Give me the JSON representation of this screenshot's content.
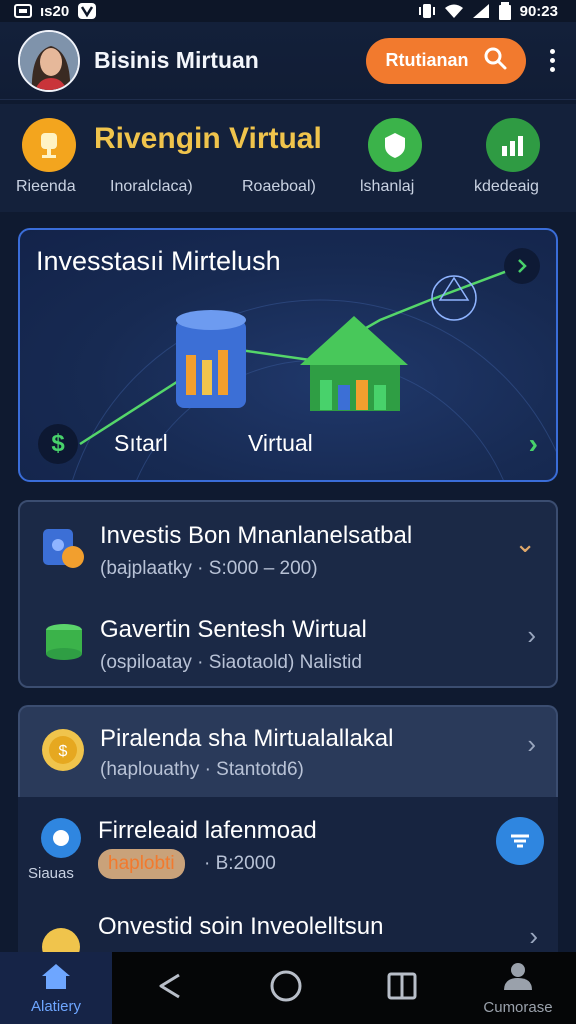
{
  "status_bar": {
    "time_left": "ıs20",
    "time_right": "90:23"
  },
  "header": {
    "title": "Bisinis Mirtuan",
    "button_label": "Rtutianan",
    "button_icon": "search-icon"
  },
  "quick": {
    "title": "Rivengin Virtual",
    "labels": [
      "Rieenda",
      "Inoralclaca)",
      "Roaeboal)",
      "lshanlaj",
      "kdedeaig"
    ]
  },
  "banner": {
    "title": "Invesstasıi Mirtelush",
    "start_label": "Sıtarl",
    "virtual_label": "Virtual"
  },
  "list": [
    {
      "title": "Investis Bon Mnanlanelsatbal",
      "subtitle": "(bajplaatky · S:000 – 200)"
    },
    {
      "title": "Gavertin Sentesh Wirtual",
      "subtitle": "(ospiloatay · Siaotaold)  Nalistid"
    },
    {
      "title": "Piralenda sha Mirtualallakal",
      "subtitle": "(haplouathy · Stantotd6)"
    },
    {
      "title": "Firreleaid lafenmoad",
      "badge": "haplobti",
      "subtitle": "· B:2000",
      "side_label": "Siauas"
    },
    {
      "title": "Onvestid soin Inveolelltsun"
    }
  ],
  "nav": {
    "home_label": "Alatiery",
    "profile_label": "Cumorase"
  },
  "colors": {
    "accent_orange": "#f27a2e",
    "accent_green": "#48d26b",
    "gold": "#f0c44c",
    "bg": "#0f1a30"
  }
}
